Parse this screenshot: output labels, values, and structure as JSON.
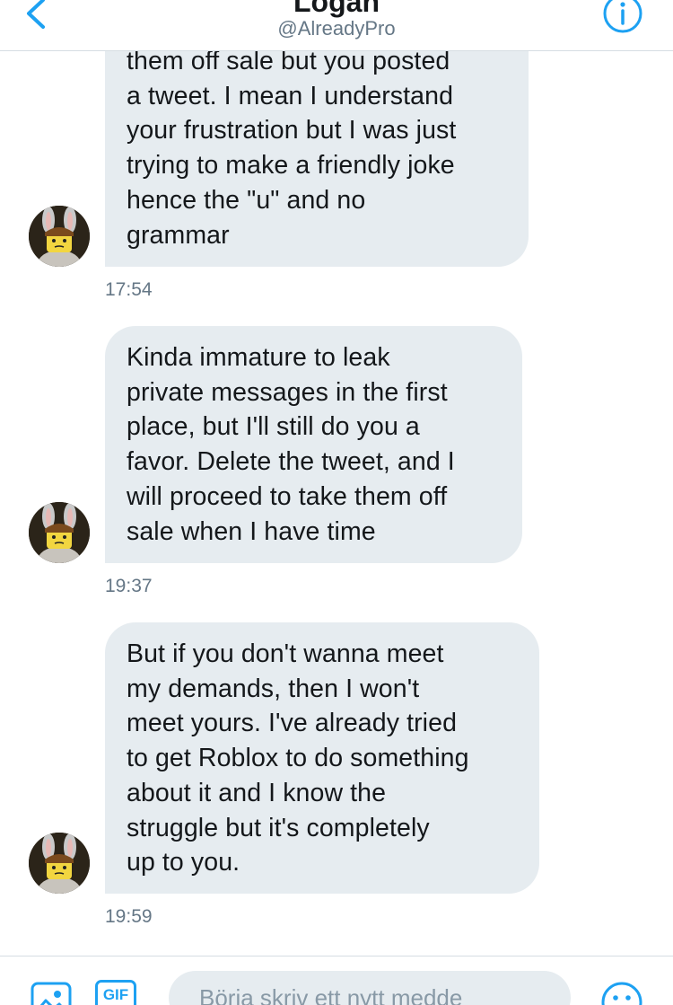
{
  "header": {
    "title": "Logan",
    "handle": "@AlreadyPro",
    "back_icon": "chevron-left-icon",
    "info_icon": "info-icon",
    "accent_color": "#1da1f2"
  },
  "messages": [
    {
      "lines": [
        "them off sale but you posted",
        "a tweet. I mean I understand",
        "your frustration but I was just",
        "trying to make a friendly joke",
        "hence the \"u\" and no",
        "grammar"
      ],
      "time": "17:54"
    },
    {
      "lines": [
        "Kinda immature to leak",
        "private messages in the first",
        "place, but I'll still do you a",
        "favor. Delete the tweet, and I",
        "will proceed to take them off",
        "sale when I have time"
      ],
      "time": "19:37"
    },
    {
      "lines": [
        "But if you don't wanna meet",
        "my demands, then I won't",
        "meet yours. I've already tried",
        "to get Roblox to do something",
        "about it and I know the",
        "struggle but it's completely",
        "up to you."
      ],
      "time": "19:59"
    }
  ],
  "composer": {
    "placeholder": "Börja skriv ett nytt medde",
    "gif_label": "GIF",
    "image_icon": "image-icon",
    "emoji_icon": "emoji-icon"
  },
  "colors": {
    "bubble": "#e6ecf0",
    "timestamp": "#657786",
    "text": "#14171a"
  }
}
